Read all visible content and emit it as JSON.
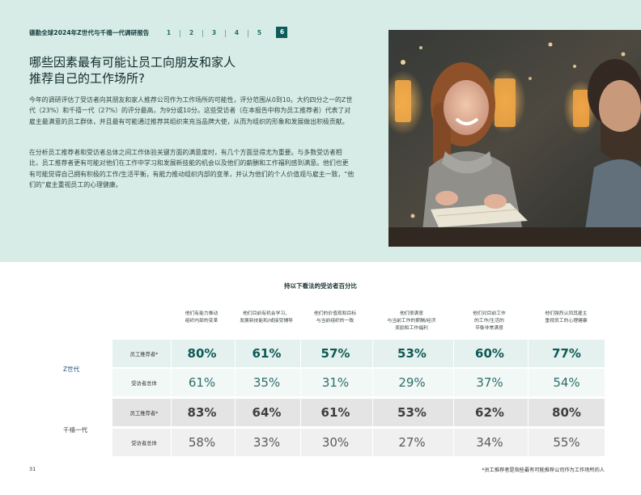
{
  "header": {
    "title": "德勤全球2024年Z世代与千禧一代调研报告",
    "nav": [
      "1",
      "2",
      "3",
      "4",
      "5",
      "6"
    ],
    "active_index": 5
  },
  "heading": {
    "line1": "哪些因素最有可能让员工向朋友和家人",
    "line2": "推荐自己的工作场所?"
  },
  "paragraphs": [
    "今年的调研评估了受访者向其朋友和家人推荐公司作为工作场所的可能性，评分范围从0到10。大约四分之一的Z世代（23%）和千禧一代（27%）的评分最高，为9分或10分。这些受访者（在本报告中称为员工推荐者）代表了对雇主最满意的员工群体，并且最有可能通过推荐其组织来充当品牌大使，从而为组织的形象和发展做出积极贡献。",
    "在分析员工推荐者和受访者总体之间工作体验关键方面的满意度时，有几个方面显得尤为重要。与多数受访者相比，员工推荐者更有可能对他们在工作中学习和发展新技能的机会以及他们的薪酬和工作福利感到满意。他们也更有可能觉得自己拥有积极的工作/生活平衡，有能力推动组织内部的变革，并认为他们的个人价值观与雇主一致，“他们的”雇主重视员工的心理健康。"
  ],
  "table": {
    "title": "持以下看法的受访者百分比",
    "columns": [
      "他们有能力推动\n组织内部的变革",
      "他们目前有机会学习、\n发展新技能和/或接受辅导",
      "他们的价值观和目标\n与当前组织的一致",
      "他们很满意\n与当前工作的薪酬/经济\n奖励和工作福利",
      "他们对目前工作\n的工作/生活的\n平衡非常满意",
      "他们强烈认同其雇主\n重视员工的心理健康"
    ],
    "groups": [
      {
        "name": "Z世代",
        "rows": [
          {
            "label": "员工推荐者*",
            "values": [
              "80%",
              "61%",
              "57%",
              "53%",
              "60%",
              "77%"
            ]
          },
          {
            "label": "受访者总体",
            "values": [
              "61%",
              "35%",
              "31%",
              "29%",
              "37%",
              "54%"
            ]
          }
        ]
      },
      {
        "name": "千禧一代",
        "rows": [
          {
            "label": "员工推荐者*",
            "values": [
              "83%",
              "64%",
              "61%",
              "53%",
              "62%",
              "80%"
            ]
          },
          {
            "label": "受访者总体",
            "values": [
              "58%",
              "33%",
              "30%",
              "27%",
              "34%",
              "55%"
            ]
          }
        ]
      }
    ]
  },
  "footer": {
    "page_number": "31",
    "footnote": "*员工推荐者是指些最有可能推荐公司作为工作场所的人"
  },
  "colors": {
    "band": "#d7ece6",
    "teal_dark": "#0e5b5a",
    "gen_z_strong": "#e5f1ee",
    "gen_z_light": "#f2f8f6",
    "mil_strong": "#e4e4e4",
    "mil_light": "#f0f0f0"
  }
}
